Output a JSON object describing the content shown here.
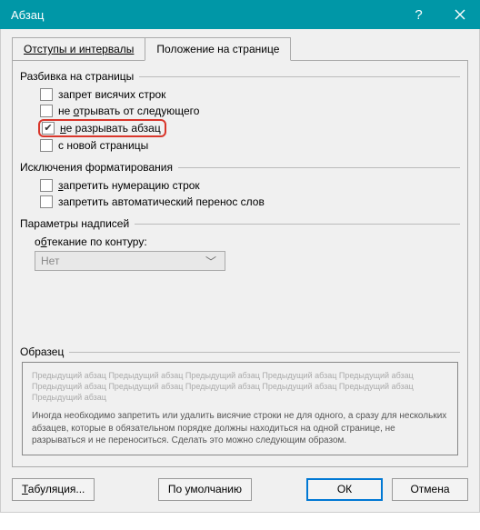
{
  "titlebar": {
    "title": "Абзац"
  },
  "tabs": {
    "t1": "Отступы и интервалы",
    "t2": "Положение на странице"
  },
  "groups": {
    "pagination": {
      "label": "Разбивка на страницы",
      "opt1": "запрет висячих строк",
      "opt2_pre": "не ",
      "opt2_u": "о",
      "opt2_post": "трывать от следующего",
      "opt3_pre": "",
      "opt3_u": "н",
      "opt3_post": "е разрывать абзац",
      "opt4": "с новой страницы"
    },
    "formatting": {
      "label": "Исключения форматирования",
      "opt1_pre": "",
      "opt1_u": "з",
      "opt1_post": "апретить нумерацию строк",
      "opt2": "запретить автоматический перенос слов"
    },
    "textbox": {
      "label": "Параметры надписей",
      "wrap_label_pre": "о",
      "wrap_label_u": "б",
      "wrap_label_post": "текание по контуру:",
      "wrap_value": "Нет"
    },
    "preview": {
      "label": "Образец",
      "lorem": "Предыдущий абзац Предыдущий абзац Предыдущий абзац Предыдущий абзац Предыдущий абзац Предыдущий абзац Предыдущий абзац Предыдущий абзац Предыдущий абзац Предыдущий абзац Предыдущий абзац",
      "desc": "Иногда необходимо запретить или удалить висячие строки не для одного, а сразу для нескольких абзацев, которые в обязательном порядке должны находиться на одной странице, не разрываться и не переноситься. Сделать это можно следующим образом."
    }
  },
  "buttons": {
    "tabs_pre": "",
    "tabs_u": "Т",
    "tabs_post": "абуляция...",
    "default": "По умолчанию",
    "ok": "ОК",
    "cancel": "Отмена"
  }
}
